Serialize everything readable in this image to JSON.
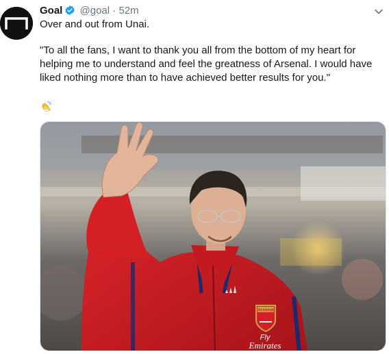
{
  "tweet": {
    "author_name": "Goal",
    "handle": "@goal",
    "separator": "·",
    "time": "52m",
    "line1": "Over and out from Unai.",
    "quote": "\"To all the fans, I want to thank you all from the bottom of my heart for helping me to understand and feel the greatness of Arsenal. I would have liked nothing more than to have achieved better results for you.\"",
    "emoji": "clapping-hands-emoji",
    "media": {
      "crest_text": "Arsenal",
      "shirt_sponsor_line1": "Fly",
      "shirt_sponsor_line2": "Emirates"
    }
  },
  "colors": {
    "text": "#14171a",
    "secondary": "#657786",
    "verified": "#1da1f2",
    "jacket": "#d61e24",
    "jacket_trim": "#1b2a6b"
  },
  "icons": [
    "goal-logo-icon",
    "verified-badge-icon",
    "chevron-down-icon"
  ]
}
